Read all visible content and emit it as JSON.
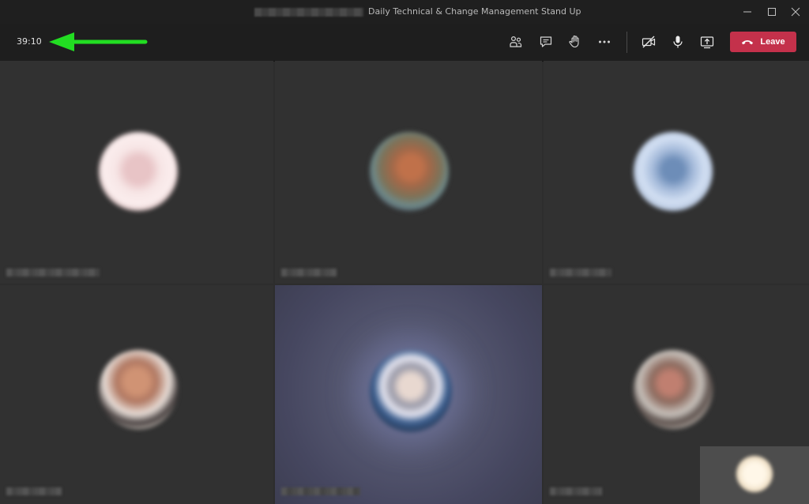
{
  "window": {
    "title": "Daily Technical & Change Management Stand Up"
  },
  "toolbar": {
    "timer": "39:10",
    "leave_label": "Leave",
    "icons": [
      "people-icon",
      "chat-icon",
      "raise-hand-icon",
      "more-options-icon",
      "camera-off-icon",
      "microphone-icon",
      "share-screen-icon"
    ]
  },
  "colors": {
    "leave_button": "#c4314b",
    "annotation_arrow": "#22dd22",
    "active_speaker_tile": "#4b4c66"
  }
}
